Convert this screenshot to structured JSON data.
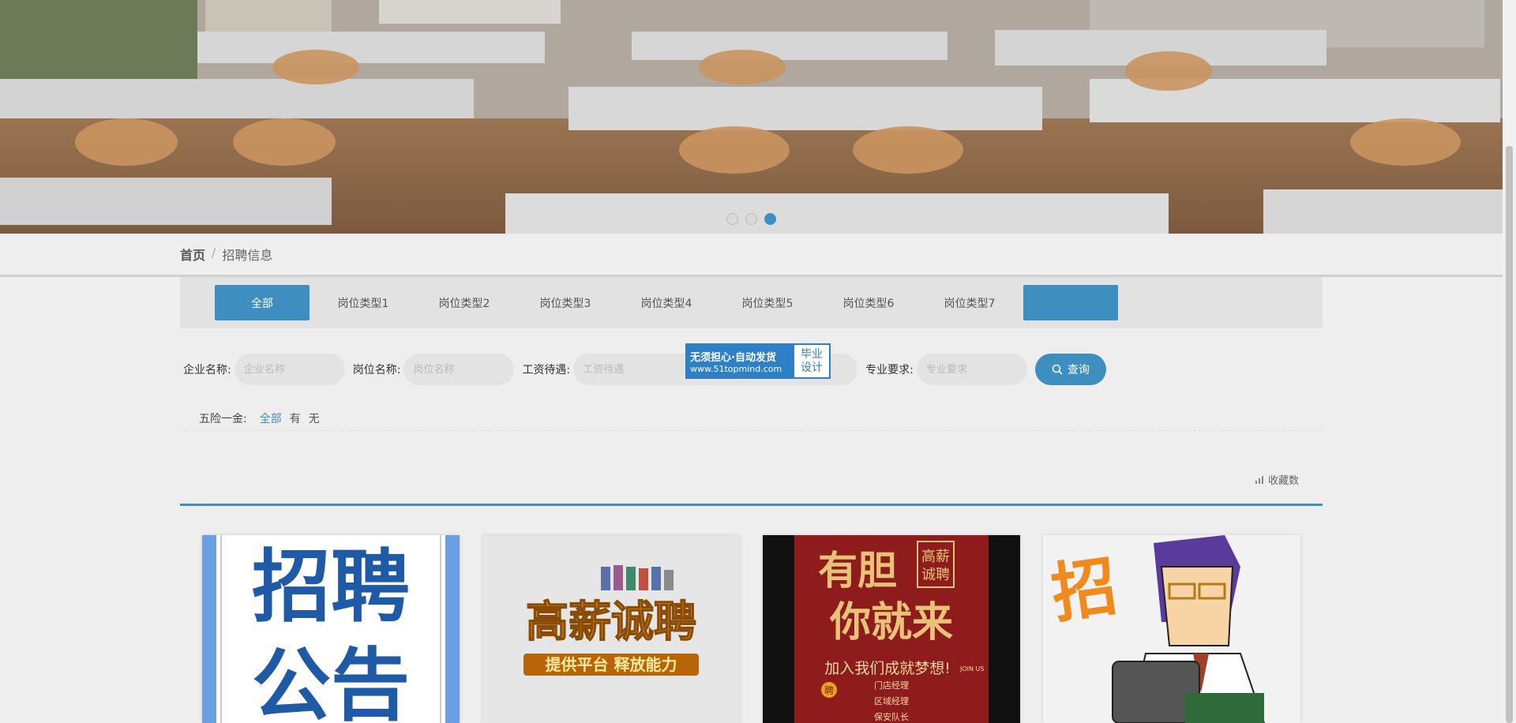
{
  "banner": {
    "slides": 3,
    "active_slide": 3
  },
  "breadcrumb": {
    "home": "首页",
    "separator": "/",
    "current": "招聘信息"
  },
  "tabs": [
    {
      "label": "全部",
      "active": true
    },
    {
      "label": "岗位类型1"
    },
    {
      "label": "岗位类型2"
    },
    {
      "label": "岗位类型3"
    },
    {
      "label": "岗位类型4"
    },
    {
      "label": "岗位类型5"
    },
    {
      "label": "岗位类型6"
    },
    {
      "label": "岗位类型7"
    },
    {
      "label": ""
    }
  ],
  "search": {
    "company_label": "企业名称:",
    "company_placeholder": "企业名称",
    "position_label": "岗位名称:",
    "position_placeholder": "岗位名称",
    "salary_label": "工资待遇:",
    "salary_placeholder": "工资待遇",
    "major_label": "专业要求:",
    "major_placeholder": "专业要求",
    "button_label": "查询"
  },
  "watermark": {
    "line1": "无须担心·自动发货",
    "line2": "www.51topmind.com",
    "right1": "毕业",
    "right2": "设计"
  },
  "filter": {
    "label": "五险一金:",
    "options": [
      "全部",
      "有",
      "无"
    ],
    "active": "全部"
  },
  "sort": {
    "label": "收藏数"
  },
  "cards": [
    {
      "text1": "招聘",
      "text2": "公告"
    },
    {
      "text1": "高薪诚聘",
      "text2": "提供平台 释放能力"
    },
    {
      "text1": "有胆",
      "text2": "你就来",
      "badge1": "高薪",
      "badge2": "诚聘",
      "slogan": "加入我们成就梦想!",
      "tag": "JOIN US",
      "role1": "门店经理",
      "role2": "区域经理",
      "role3": "保安队长",
      "mark": "聘"
    },
    {
      "text1": "招"
    }
  ],
  "colors": {
    "accent": "#3e8fbf",
    "background": "#eeeeee"
  }
}
